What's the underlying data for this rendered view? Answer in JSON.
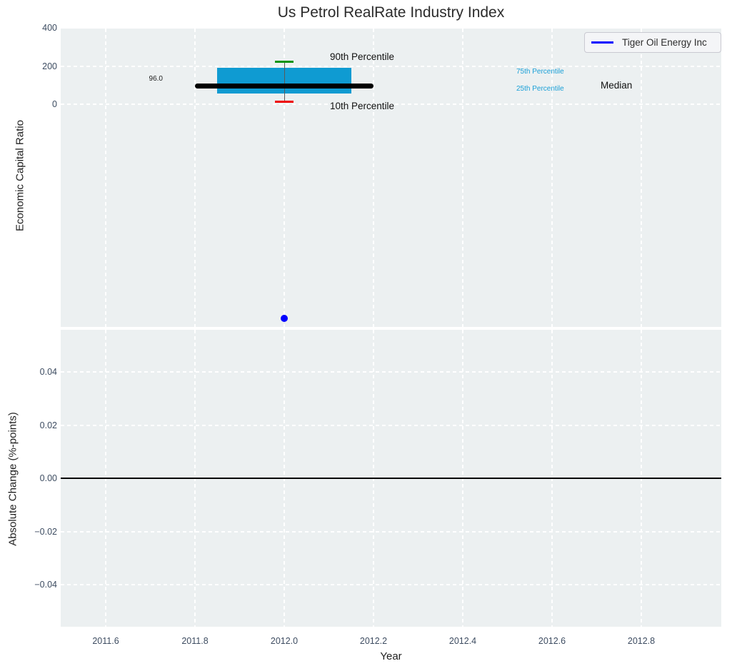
{
  "chart_data": {
    "type": "box",
    "title": "Us Petrol RealRate Industry Index",
    "xlabel": "Year",
    "x_ticks": [
      {
        "label": "2011.6",
        "value": 2011.6
      },
      {
        "label": "2011.8",
        "value": 2011.8
      },
      {
        "label": "2012.0",
        "value": 2012.0
      },
      {
        "label": "2012.2",
        "value": 2012.2
      },
      {
        "label": "2012.4",
        "value": 2012.4
      },
      {
        "label": "2012.6",
        "value": 2012.6
      },
      {
        "label": "2012.8",
        "value": 2012.8
      }
    ],
    "top_subplot": {
      "ylabel": "Economic Capital Ratio",
      "y_ticks": [
        {
          "label": "400",
          "value": 400
        },
        {
          "label": "200",
          "value": 200
        },
        {
          "label": "0",
          "value": 0
        }
      ],
      "box": {
        "year": 2012.0,
        "box_half_width": 0.15,
        "median_half_width": 0.2,
        "cap_half_width": 0.021,
        "p10": 12,
        "p25": 57,
        "median": 96.0,
        "p75": 190,
        "p90": 222,
        "median_value_label": "96.0",
        "box_color": "#0f9bd2",
        "p90_cap_color": "#0a9410",
        "p10_cap_color": "#ee0000",
        "median_color": "#000000"
      },
      "company_point": {
        "year": 2012.0,
        "value": -1120,
        "color": "#0000ff"
      },
      "annotations": {
        "p90": "90th Percentile",
        "p10": "10th Percentile",
        "p75": "75th Percentile",
        "p25": "25th Percentile",
        "median": "Median",
        "percentile_label_color": "#1ba0d7"
      }
    },
    "bottom_subplot": {
      "ylabel": "Absolute Change (%-points)",
      "y_ticks": [
        {
          "label": "0.04",
          "value": 0.04
        },
        {
          "label": "0.02",
          "value": 0.02
        },
        {
          "label": "0.00",
          "value": 0.0
        },
        {
          "label": "−0.02",
          "value": -0.02
        },
        {
          "label": "−0.04",
          "value": -0.04
        }
      ],
      "zero_line_value": 0
    },
    "legend": {
      "label": "Tiger Oil Energy Inc",
      "line_color": "#0000ff"
    },
    "layout_hints": {
      "grid": "white dashed on light gray",
      "legend_position": "upper right",
      "axes_background": "#ecf0f1",
      "tick_color": "#3d4c61"
    }
  }
}
